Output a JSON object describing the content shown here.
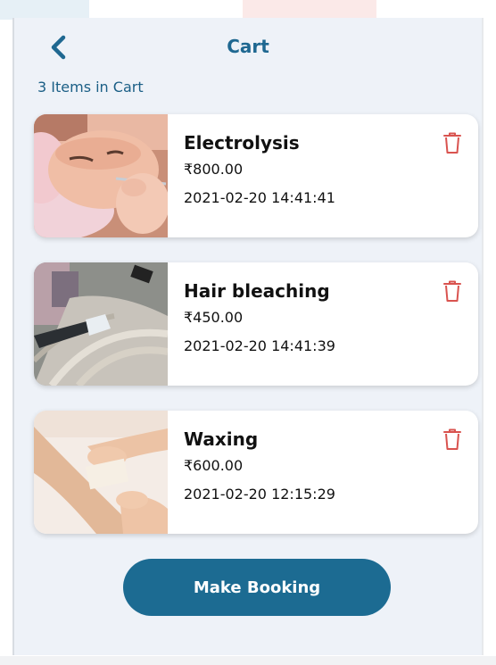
{
  "header": {
    "title": "Cart",
    "back_icon": "chevron-left-icon"
  },
  "summary": {
    "items_count_text": "3 Items in Cart"
  },
  "cart": {
    "items": [
      {
        "name": "Electrolysis",
        "price": "₹800.00",
        "datetime": "2021-02-20 14:41:41",
        "image": "facial-electrolysis-photo",
        "delete_icon": "trash-icon"
      },
      {
        "name": "Hair bleaching",
        "price": "₹450.00",
        "datetime": "2021-02-20 14:41:39",
        "image": "hair-bleaching-photo",
        "delete_icon": "trash-icon"
      },
      {
        "name": "Waxing",
        "price": "₹600.00",
        "datetime": "2021-02-20 12:15:29",
        "image": "arm-waxing-photo",
        "delete_icon": "trash-icon"
      }
    ]
  },
  "actions": {
    "make_booking_label": "Make Booking"
  },
  "colors": {
    "accent": "#1c6b92",
    "title": "#1f6891",
    "delete": "#d9534f",
    "background": "#eef2f8"
  }
}
